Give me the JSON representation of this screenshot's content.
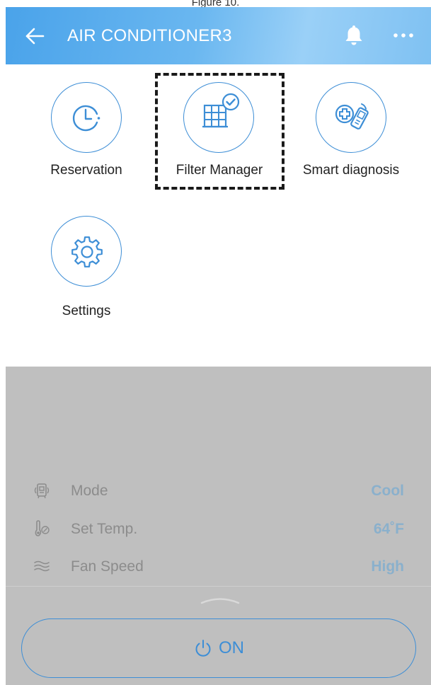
{
  "figure_caption": "Figure 10.",
  "header": {
    "title": "AIR CONDITIONER3"
  },
  "menu": {
    "items": [
      {
        "id": "reservation",
        "label": "Reservation",
        "icon": "clock-icon"
      },
      {
        "id": "filter_manager",
        "label": "Filter Manager",
        "icon": "filter-check-icon",
        "highlighted": true
      },
      {
        "id": "smart_diagnosis",
        "label": "Smart diagnosis",
        "icon": "phone-diagnosis-icon"
      },
      {
        "id": "settings",
        "label": "Settings",
        "icon": "gear-icon"
      }
    ]
  },
  "status": {
    "rows": [
      {
        "label": "Mode",
        "value": "Cool",
        "icon": "mode-icon"
      },
      {
        "label": "Set Temp.",
        "value": "64˚F",
        "icon": "thermometer-icon"
      },
      {
        "label": "Fan Speed",
        "value": "High",
        "icon": "fan-wind-icon"
      }
    ]
  },
  "power": {
    "label": "ON",
    "icon": "power-icon"
  },
  "colors": {
    "accent": "#3d8ed6",
    "header_gradient_start": "#4aa3ea",
    "panel_bg": "#bfbfbf",
    "status_value": "#8ab0cc",
    "status_label": "#8c8c8c"
  }
}
